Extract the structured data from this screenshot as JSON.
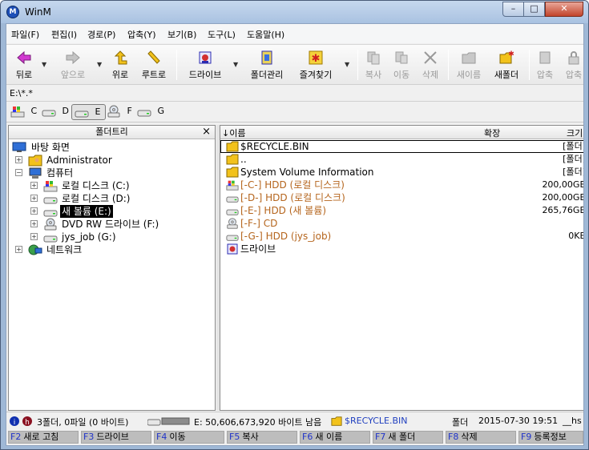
{
  "window": {
    "title": "WinM"
  },
  "titlebar": {
    "min": "–",
    "max": "□",
    "close": "✕"
  },
  "menu": [
    "파일(F)",
    "편집(I)",
    "경로(P)",
    "압축(Y)",
    "보기(B)",
    "도구(L)",
    "도움말(H)"
  ],
  "toolbar": {
    "back": "뒤로",
    "forward": "앞으로",
    "up": "위로",
    "root": "루트로",
    "drive": "드라이브",
    "folder_manage": "폴더관리",
    "favorites": "즐겨찾기",
    "copy": "복사",
    "move": "이동",
    "delete": "삭제",
    "rename": "새이름",
    "new_folder": "새폴더",
    "compress": "압축",
    "compress2": "압축",
    "dropdown": "▼"
  },
  "path": "E:\\*.*",
  "drives": [
    "C",
    "D",
    "E",
    "F",
    "G"
  ],
  "tree": {
    "header": "폴더트리",
    "close": "×",
    "items": [
      {
        "label": "바탕 화면",
        "icon": "desktop-icon"
      },
      {
        "label": "Administrator",
        "icon": "user-folder-icon"
      },
      {
        "label": "컴퓨터",
        "icon": "computer-icon"
      },
      {
        "label": "로컬 디스크 (C:)",
        "icon": "system-drive-icon"
      },
      {
        "label": "로컬 디스크 (D:)",
        "icon": "drive-icon"
      },
      {
        "label": "새 볼륨 (E:)",
        "icon": "drive-icon"
      },
      {
        "label": "DVD RW 드라이브 (F:)",
        "icon": "dvd-icon"
      },
      {
        "label": "jys_job (G:)",
        "icon": "drive-icon"
      },
      {
        "label": "네트워크",
        "icon": "network-icon"
      }
    ],
    "expand_plus": "+",
    "expand_minus": "−"
  },
  "list": {
    "col_name": "↓이름",
    "col_ext": "확장",
    "col_size": "크기",
    "rows": [
      {
        "name": "$RECYCLE.BIN",
        "size": "[폴더]",
        "icon": "folder-icon"
      },
      {
        "name": "..",
        "size": "[폴더]",
        "icon": "folder-icon"
      },
      {
        "name": "System Volume Information",
        "size": "[폴더]",
        "icon": "folder-icon"
      },
      {
        "name": "[-C-] HDD (로컬 디스크)",
        "size": "200,00GB",
        "icon": "system-drive-icon"
      },
      {
        "name": "[-D-] HDD (로컬 디스크)",
        "size": "200,00GB",
        "icon": "drive-icon"
      },
      {
        "name": "[-E-] HDD (새 볼륨)",
        "size": "265,76GB",
        "icon": "drive-icon"
      },
      {
        "name": "[-F-] CD",
        "size": "",
        "icon": "dvd-icon"
      },
      {
        "name": "[-G-] HDD (jys_job)",
        "size": "0KB",
        "icon": "drive-icon"
      },
      {
        "name": "드라이브",
        "size": "",
        "icon": "drive-app-icon"
      }
    ]
  },
  "status": {
    "counts": "3폴더, 0파일 (0 바이트)",
    "free": "E: 50,606,673,920 바이트 남음",
    "current": "$RECYCLE.BIN",
    "type": "폴더",
    "date": "2015-07-30 19:51",
    "attr": "__hs"
  },
  "fkeys": [
    {
      "key": "F2",
      "label": "새로 고침"
    },
    {
      "key": "F3",
      "label": "드라이브"
    },
    {
      "key": "F4",
      "label": "이동"
    },
    {
      "key": "F5",
      "label": "복사"
    },
    {
      "key": "F6",
      "label": "새 이름"
    },
    {
      "key": "F7",
      "label": "새 폴더"
    },
    {
      "key": "F8",
      "label": "삭제"
    },
    {
      "key": "F9",
      "label": "등록정보"
    }
  ],
  "colors": {
    "accent": "#1f3fbf",
    "drive_text": "#b5651d",
    "fkey_bg": "#bdbdbd"
  }
}
